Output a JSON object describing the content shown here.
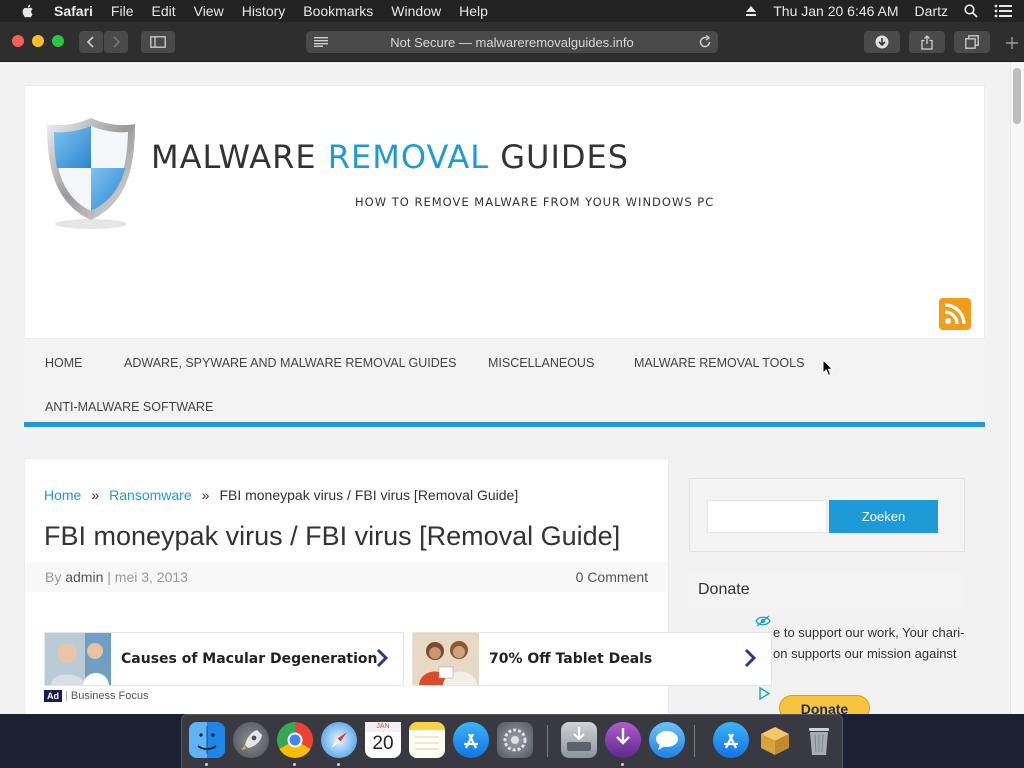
{
  "menubar": {
    "apple_icon": "apple-logo-icon",
    "items": [
      "Safari",
      "File",
      "Edit",
      "View",
      "History",
      "Bookmarks",
      "Window",
      "Help"
    ],
    "clock": "Thu Jan 20  6:46 AM",
    "user": "Dartz"
  },
  "browser": {
    "address": "Not Secure — malwareremovalguides.info"
  },
  "site": {
    "title_part1": "MALWARE ",
    "title_accent": "REMOVAL",
    "title_part2": " GUIDES",
    "tagline": "HOW TO REMOVE MALWARE FROM YOUR WINDOWS PC",
    "accent_color": "#1e9bd7"
  },
  "nav": {
    "items": [
      "HOME",
      "ADWARE, SPYWARE AND MALWARE REMOVAL GUIDES",
      "MISCELLANEOUS",
      "MALWARE REMOVAL TOOLS",
      "ANTI-MALWARE SOFTWARE"
    ]
  },
  "breadcrumb": {
    "home": "Home",
    "sep": "»",
    "category": "Ransomware",
    "current": "FBI moneypak virus / FBI virus [Removal Guide]"
  },
  "post": {
    "title": "FBI moneypak virus / FBI virus [Removal Guide]",
    "by": "By ",
    "author": "admin",
    "date": " | mei 3, 2013",
    "comments": "0 Comment"
  },
  "ads": {
    "items": [
      {
        "text": "Causes of Macular Degeneration"
      },
      {
        "text": "70% Off Tablet Deals"
      }
    ],
    "tag": "Ad",
    "source": "Business Focus"
  },
  "sidebar": {
    "search_button": "Zoeken",
    "search_placeholder": "",
    "donate_heading": "Donate",
    "donate_line1": "e to support our work, Your chari-",
    "donate_line2": "on supports our mission against",
    "donate_button": "Donate"
  },
  "dock": {
    "apps": [
      "Finder",
      "Launchpad",
      "Chrome",
      "Safari",
      "Calendar",
      "Notes",
      "App Store",
      "System Preferences",
      "Disk Utility",
      "Downloads",
      "Messages",
      "App Store",
      "Archive Utility",
      "Trash"
    ],
    "calendar_month": "JAN",
    "calendar_day": "20"
  }
}
